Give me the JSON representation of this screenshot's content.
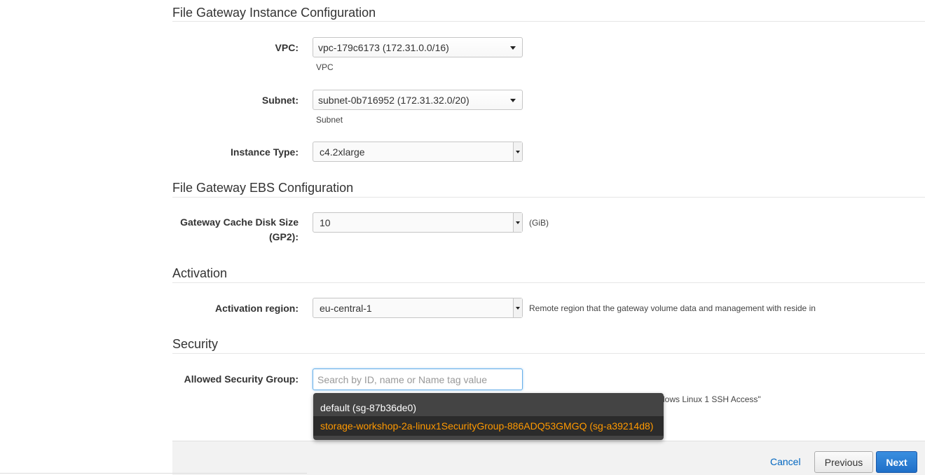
{
  "sections": {
    "instance": "File Gateway Instance Configuration",
    "ebs": "File Gateway EBS Configuration",
    "activation": "Activation",
    "security": "Security"
  },
  "vpc": {
    "label": "VPC:",
    "value": "vpc-179c6173 (172.31.0.0/16)",
    "hint": "VPC"
  },
  "subnet": {
    "label": "Subnet:",
    "value": "subnet-0b716952 (172.31.32.0/20)",
    "hint": "Subnet"
  },
  "instance_type": {
    "label": "Instance Type:",
    "value": "c4.2xlarge"
  },
  "cache_disk": {
    "label": "Gateway Cache Disk Size (GP2):",
    "value": "10",
    "unit": "(GiB)"
  },
  "activation_region": {
    "label": "Activation region:",
    "value": "eu-central-1",
    "hint": "Remote region that the gateway volume data and management with reside in"
  },
  "security_group": {
    "label": "Allowed Security Group:",
    "placeholder": "Search by ID, name or Name tag value",
    "partial_hint": "lows Linux 1 SSH Access\"",
    "options": [
      "default (sg-87b36de0)",
      "storage-workshop-2a-linux1SecurityGroup-886ADQ53GMGQ (sg-a39214d8)"
    ]
  },
  "footer": {
    "cancel": "Cancel",
    "previous": "Previous",
    "next": "Next"
  },
  "colors": {
    "primary": "#1f6fc8",
    "highlight": "#ff9900",
    "link": "#0066c0"
  }
}
